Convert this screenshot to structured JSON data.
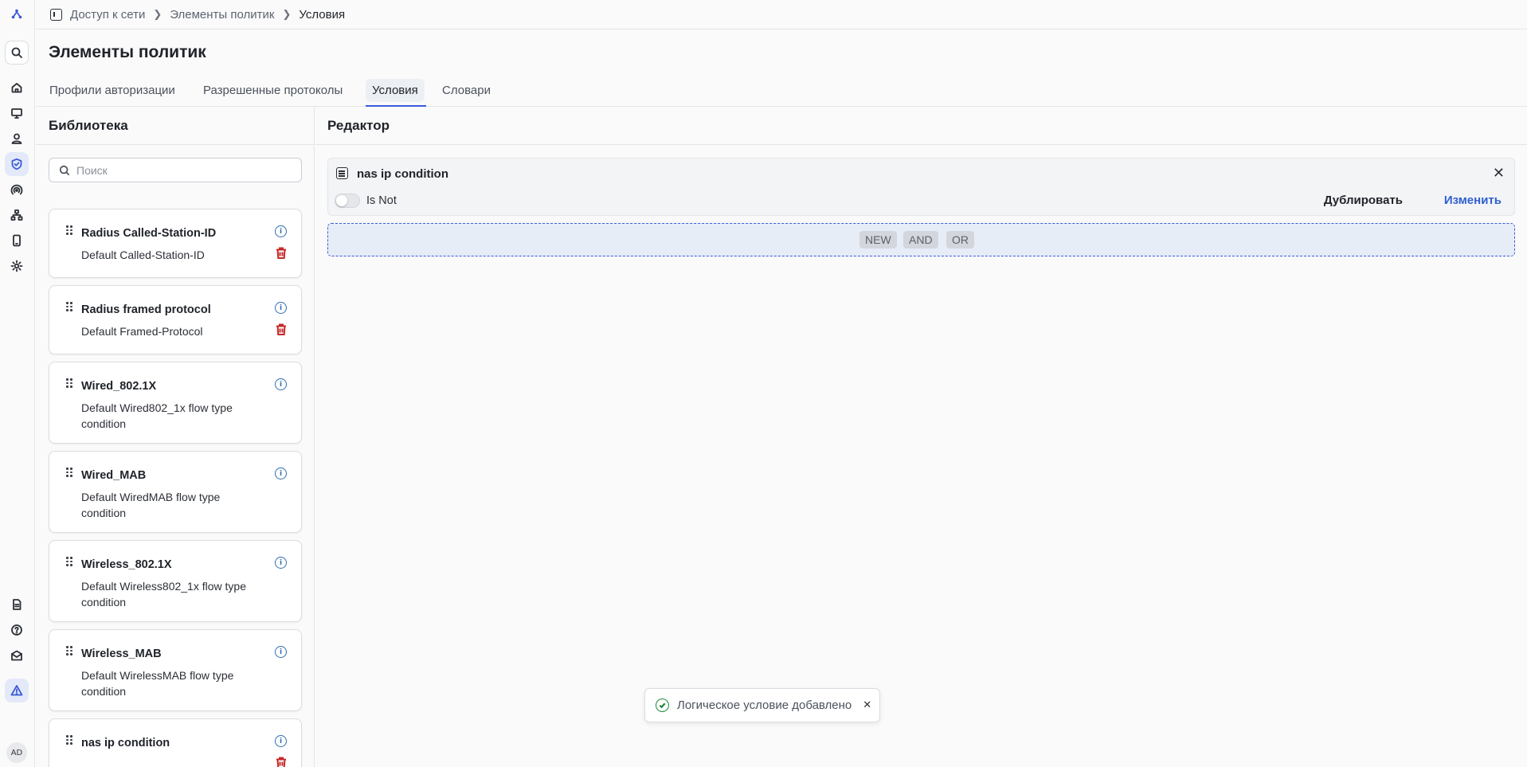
{
  "breadcrumb": {
    "items": [
      "Доступ к сети",
      "Элементы политик",
      "Условия"
    ]
  },
  "page_title": "Элементы политик",
  "tabs": [
    {
      "label": "Профили авторизации",
      "active": false
    },
    {
      "label": "Разрешенные протоколы",
      "active": false
    },
    {
      "label": "Условия",
      "active": true
    },
    {
      "label": "Словари",
      "active": false
    }
  ],
  "sidebar": {
    "icons": [
      "logo-icon",
      "search-icon",
      "home-icon",
      "monitor-icon",
      "user-icon",
      "shield-icon",
      "wifi-icon",
      "network-icon",
      "device-icon",
      "gear-icon",
      "docs-icon",
      "help-icon",
      "mail-icon",
      "alert-icon"
    ],
    "avatar": "AD"
  },
  "library": {
    "title": "Библиотека",
    "search_placeholder": "Поиск",
    "items": [
      {
        "name": "Radius Called-Station-ID",
        "desc": "Default Called-Station-ID",
        "deletable": true
      },
      {
        "name": "Radius framed protocol",
        "desc": "Default Framed-Protocol",
        "deletable": true
      },
      {
        "name": "Wired_802.1X",
        "desc": "Default Wired802_1x flow type condition",
        "deletable": false
      },
      {
        "name": "Wired_MAB",
        "desc": "Default WiredMAB flow type condition",
        "deletable": false
      },
      {
        "name": "Wireless_802.1X",
        "desc": "Default Wireless802_1x flow type condition",
        "deletable": false
      },
      {
        "name": "Wireless_MAB",
        "desc": "Default WirelessMAB flow type condition",
        "deletable": false
      },
      {
        "name": "nas ip condition",
        "desc": "",
        "deletable": true
      }
    ]
  },
  "editor": {
    "title": "Редактор",
    "condition_name": "nas ip condition",
    "is_not_label": "Is Not",
    "is_not_checked": false,
    "duplicate_label": "Дублировать",
    "edit_label": "Изменить",
    "chips": [
      "NEW",
      "AND",
      "OR"
    ]
  },
  "toast": {
    "message": "Логическое условие добавлено"
  },
  "colors": {
    "accent": "#3b5bd9",
    "link": "#2f5fd0",
    "danger": "#c62828",
    "info": "#2f6fb0",
    "success": "#1f8a3a"
  }
}
